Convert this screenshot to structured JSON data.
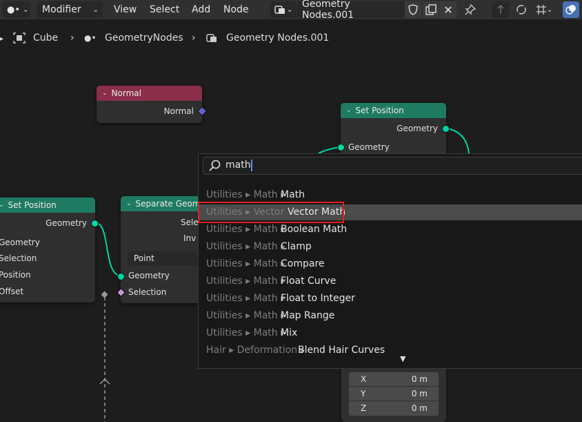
{
  "header": {
    "modifier_label": "Modifier",
    "menu": [
      "View",
      "Select",
      "Add",
      "Node"
    ],
    "node_tree_name": "Geometry Nodes.001"
  },
  "breadcrumb": {
    "object": "Cube",
    "modifier": "GeometryNodes",
    "node_tree": "Geometry Nodes.001"
  },
  "nodes": {
    "normal": {
      "title": "Normal",
      "output": "Normal",
      "color": "#8a2e4a"
    },
    "set_position_top": {
      "title": "Set Position",
      "output": "Geometry",
      "input": "Geometry",
      "color": "#1f7a62"
    },
    "set_position_left": {
      "title": "Set Position",
      "output": "Geometry",
      "inputs": [
        "Geometry",
        "Selection",
        "Position",
        "Offset"
      ],
      "color": "#1f7a62"
    },
    "separate_geometry": {
      "title": "Separate Geom",
      "outputs": [
        "Sele",
        "Inv"
      ],
      "domain": "Point",
      "inputs": [
        "Geometry",
        "Selection"
      ],
      "color": "#1f7a62"
    },
    "offset_node": {
      "rows": [
        {
          "axis": "X",
          "value": "0 m"
        },
        {
          "axis": "Y",
          "value": "0 m"
        },
        {
          "axis": "Z",
          "value": "0 m"
        }
      ]
    }
  },
  "search": {
    "query": "math",
    "results": [
      {
        "path": "Utilities ▸ Math ▸",
        "name": "Math"
      },
      {
        "path": "Utilities ▸ Vector",
        "name": "Vector Math",
        "highlighted": true
      },
      {
        "path": "Utilities ▸ Math ▸",
        "name": "Boolean Math"
      },
      {
        "path": "Utilities ▸ Math ▸",
        "name": "Clamp"
      },
      {
        "path": "Utilities ▸ Math ▸",
        "name": "Compare"
      },
      {
        "path": "Utilities ▸ Math ▸",
        "name": "Float Curve"
      },
      {
        "path": "Utilities ▸ Math ▸",
        "name": "Float to Integer"
      },
      {
        "path": "Utilities ▸ Math ▸",
        "name": "Map Range"
      },
      {
        "path": "Utilities ▸ Math ▸",
        "name": "Mix"
      },
      {
        "path": "Hair ▸ Deformation ▸",
        "name": "Blend Hair Curves"
      }
    ]
  }
}
